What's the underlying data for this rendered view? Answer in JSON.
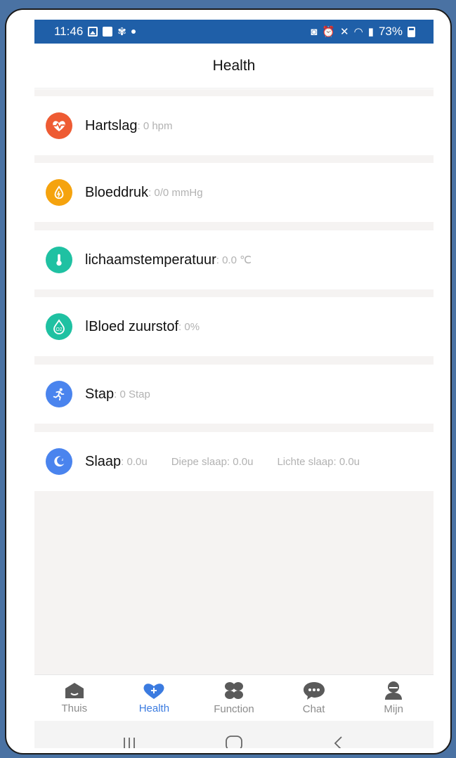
{
  "status_bar": {
    "time": "11:46",
    "battery": "73%",
    "left_icons": [
      "image-icon",
      "check-box-icon",
      "fan-icon",
      "dot-icon"
    ],
    "right_icons": [
      "lock-icon",
      "alarm-icon",
      "mute-icon",
      "wifi-icon",
      "signal-icon",
      "battery-icon"
    ]
  },
  "header": {
    "title": "Health"
  },
  "items": [
    {
      "label": "Hartslag",
      "value": ": 0 hpm",
      "icon": "heart-rate-icon",
      "color": "#ee5b33"
    },
    {
      "label": "Bloeddruk",
      "value": ": 0/0 mmHg",
      "icon": "blood-drop-icon",
      "color": "#f5a30e"
    },
    {
      "label": "lichaamstemperatuur",
      "value": ": 0.0 ℃",
      "icon": "thermometer-icon",
      "color": "#1fc1a2"
    },
    {
      "label": "ǀBloed zuurstof",
      "value": ": 0%",
      "icon": "oxygen-icon",
      "color": "#1fc1a2"
    },
    {
      "label": "Stap",
      "value": ": 0 Stap",
      "icon": "runner-icon",
      "color": "#4a84ee"
    },
    {
      "label": "Slaap",
      "value": ": 0.0u",
      "extra1": "Diepe slaap: 0.0u",
      "extra2": "Lichte slaap: 0.0u",
      "icon": "moon-icon",
      "color": "#4a84ee"
    }
  ],
  "tabs": [
    {
      "label": "Thuis",
      "icon": "home-icon",
      "active": false
    },
    {
      "label": "Health",
      "icon": "heart-plus-icon",
      "active": true
    },
    {
      "label": "Function",
      "icon": "clover-icon",
      "active": false
    },
    {
      "label": "Chat",
      "icon": "chat-bubble-icon",
      "active": false
    },
    {
      "label": "Mijn",
      "icon": "person-icon",
      "active": false
    }
  ],
  "nav": [
    "recent-apps-icon",
    "home-circle-icon",
    "back-icon"
  ],
  "colors": {
    "status_bar": "#1f5fa8",
    "active_tab": "#3b7be0",
    "inactive": "#5a5a5a"
  }
}
